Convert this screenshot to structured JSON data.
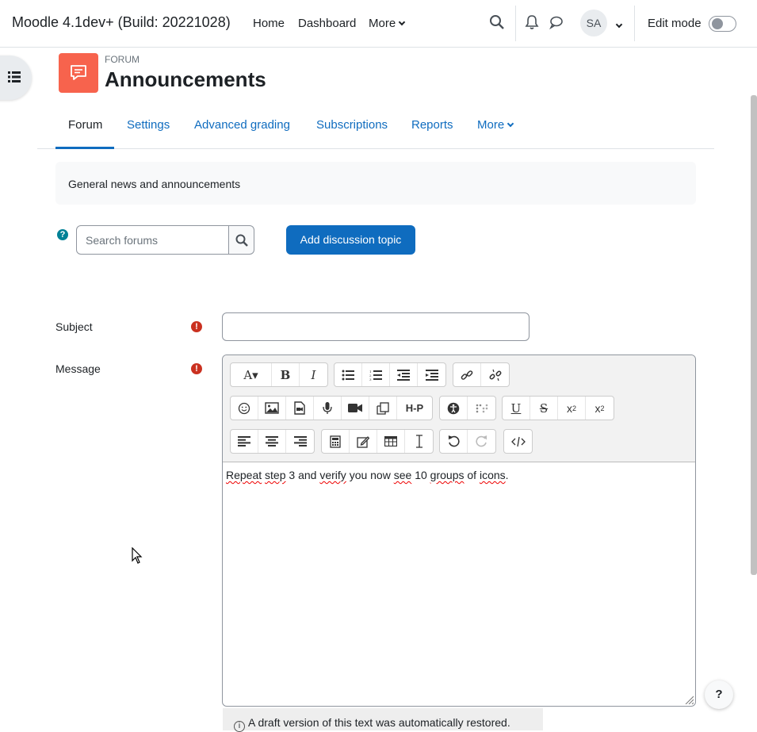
{
  "header": {
    "site_name": "Moodle 4.1dev+ (Build: 20221028)",
    "nav": [
      "Home",
      "Dashboard",
      "More"
    ],
    "avatar_initials": "SA",
    "edit_mode_label": "Edit mode"
  },
  "module": {
    "type_label": "FORUM",
    "title": "Announcements",
    "icon_color": "#f7634d"
  },
  "tabs": [
    "Forum",
    "Settings",
    "Advanced grading",
    "Subscriptions",
    "Reports",
    "More"
  ],
  "intro": "General news and announcements",
  "search": {
    "placeholder": "Search forums"
  },
  "add_button": "Add discussion topic",
  "form": {
    "subject_label": "Subject",
    "message_label": "Message",
    "subject_value": ""
  },
  "editor": {
    "toolbar_rows": [
      [
        [
          "font-icon",
          "bold-icon",
          "italic-icon"
        ],
        [
          "bullet-list-icon",
          "numbered-list-icon",
          "outdent-icon",
          "indent-icon"
        ],
        [
          "link-icon",
          "unlink-icon"
        ]
      ],
      [
        [
          "emoji-icon",
          "image-icon",
          "media-icon",
          "record-audio-icon",
          "record-video-icon",
          "manage-files-icon",
          "h5p-icon"
        ],
        [
          "accessibility-checker-icon",
          "screenreader-helper-icon"
        ],
        [
          "underline-icon",
          "strikethrough-icon",
          "subscript-icon",
          "superscript-icon"
        ]
      ],
      [
        [
          "align-left-icon",
          "align-center-icon",
          "align-right-icon"
        ],
        [
          "equation-icon",
          "character-map-icon",
          "table-icon",
          "clear-formatting-icon"
        ],
        [
          "undo-icon",
          "redo-icon"
        ],
        [
          "html-icon"
        ]
      ]
    ],
    "content_words": [
      "Repeat",
      "step",
      "3 and",
      "verify",
      "you now",
      "see",
      "10",
      "groups",
      "of",
      "icons",
      "."
    ],
    "draft_notice": "A draft version of this text was automatically restored."
  },
  "colors": {
    "primary": "#0f6cbf",
    "required": "#ca3120",
    "help": "#008196"
  }
}
